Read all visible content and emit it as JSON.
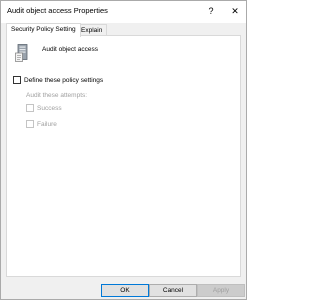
{
  "window": {
    "title": "Audit object access Properties",
    "help_glyph": "?",
    "close_glyph": "✕"
  },
  "tabs": [
    {
      "label": "Security Policy Setting",
      "active": true
    },
    {
      "label": "Explain",
      "active": false
    }
  ],
  "policy": {
    "name": "Audit object access",
    "icon": "policy-server-icon"
  },
  "options": {
    "define_label": "Define these policy settings",
    "define_checked": false,
    "audit_attempts_label": "Audit these attempts:",
    "success_label": "Success",
    "success_checked": false,
    "success_enabled": false,
    "failure_label": "Failure",
    "failure_checked": false,
    "failure_enabled": false
  },
  "buttons": {
    "ok": "OK",
    "cancel": "Cancel",
    "apply": "Apply",
    "apply_enabled": false
  },
  "colors": {
    "dialog_bg": "#f0f0f0",
    "panel_bg": "#ffffff",
    "disabled_text": "#a0a0a0",
    "focus_border": "#0078d7"
  }
}
